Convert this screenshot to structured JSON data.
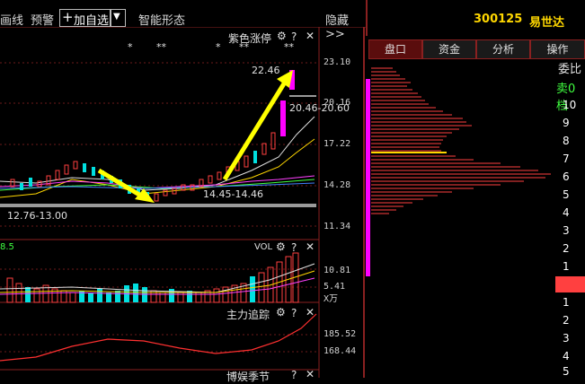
{
  "toolbar": {
    "line_label": "画线",
    "alert_label": "预警",
    "add_watch_label": "加自选",
    "smart_shape_label": "智能形态",
    "hide_label": "隐藏>>"
  },
  "stock": {
    "code": "300125",
    "name": "易世达"
  },
  "main_chart": {
    "indicator_label": "紫色涨停",
    "price_ticks": [
      "23.10",
      "20.16",
      "17.22",
      "14.28",
      "11.34"
    ],
    "annotations": {
      "high": "22.46",
      "mid": "20.46-20.60",
      "support": "14.45-14.46",
      "low": "12.76-13.00"
    },
    "stars": [
      "*",
      "**",
      "*",
      "**",
      "**"
    ]
  },
  "vol_panel": {
    "label": "VOL",
    "left_value": "8.5",
    "ticks": [
      "10.81",
      "5.41"
    ],
    "unit": "X万"
  },
  "trace_panel": {
    "label": "主力追踪",
    "ticks": [
      "185.52",
      "168.44"
    ]
  },
  "bottom_panel_label": "博娱季节",
  "right_tabs": [
    "盘口",
    "资金",
    "分析",
    "操作"
  ],
  "order_book": {
    "header": "委比",
    "sell_label": "卖0档",
    "sell_levels": [
      "10",
      "9",
      "8",
      "7",
      "6",
      "5",
      "4",
      "3",
      "2",
      "1"
    ],
    "buy_levels": [
      "1",
      "2",
      "3",
      "4",
      "5"
    ]
  }
}
